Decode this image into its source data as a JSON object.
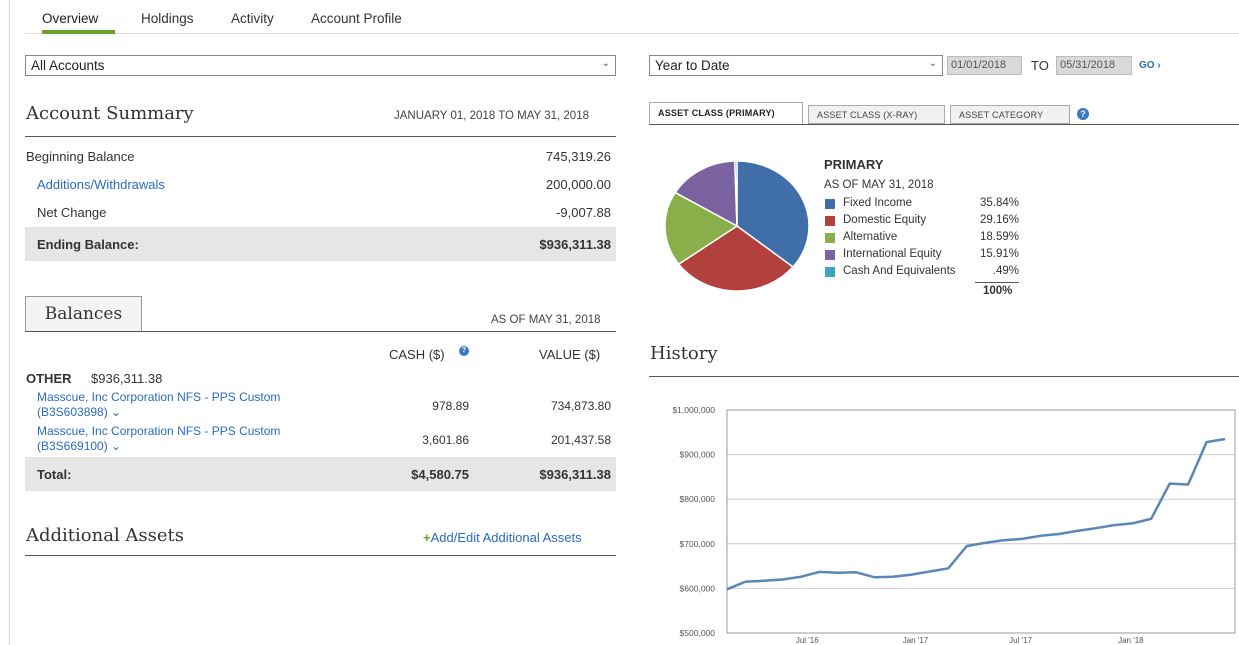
{
  "nav": {
    "tabs": [
      {
        "label": "Overview",
        "active": true
      },
      {
        "label": "Holdings",
        "active": false
      },
      {
        "label": "Activity",
        "active": false
      },
      {
        "label": "Account Profile",
        "active": false
      }
    ],
    "accent_color": "#6aa12c"
  },
  "filters": {
    "account_select": "All Accounts",
    "period_select": "Year to Date",
    "from_date": "01/01/2018",
    "to_label": "TO",
    "to_date": "05/31/2018",
    "go_label": "GO ›"
  },
  "account_summary": {
    "title": "Account Summary",
    "date_range": "JANUARY 01, 2018 TO MAY 31, 2018",
    "rows": [
      {
        "label": "Beginning Balance",
        "value": "745,319.26"
      },
      {
        "label": "Additions/Withdrawals",
        "value": "200,000.00"
      },
      {
        "label": "Net Change",
        "value": "-9,007.88"
      }
    ],
    "ending_label": "Ending Balance:",
    "ending_value": "$936,311.38"
  },
  "balances": {
    "title": "Balances",
    "as_of": "AS OF MAY 31, 2018",
    "col_cash": "CASH ($)",
    "col_value": "VALUE ($)",
    "group_label": "OTHER",
    "group_total": "$936,311.38",
    "accounts": [
      {
        "name_line1": "Masscue, Inc Corporation NFS - PPS Custom",
        "name_line2": "(B3S603898) ⌄",
        "cash": "978.89",
        "value": "734,873.80"
      },
      {
        "name_line1": "Masscue, Inc Corporation NFS - PPS Custom",
        "name_line2": "(B3S669100) ⌄",
        "cash": "3,601.86",
        "value": "201,437.58"
      }
    ],
    "total_label": "Total:",
    "total_cash": "$4,580.75",
    "total_value": "$936,311.38"
  },
  "additional_assets": {
    "title": "Additional Assets",
    "link": "Add/Edit Additional Assets",
    "link_plus": "+"
  },
  "asset_tabs": [
    {
      "label": "ASSET CLASS (PRIMARY)",
      "active": true
    },
    {
      "label": "ASSET CLASS (X-RAY)",
      "active": false
    },
    {
      "label": "ASSET CATEGORY",
      "active": false
    }
  ],
  "allocation": {
    "title": "PRIMARY",
    "as_of": "AS OF MAY 31, 2018",
    "total": "100%",
    "items": [
      {
        "label": "Fixed Income",
        "pct": "35.84%",
        "value": 35.84,
        "color": "#3f6ea8"
      },
      {
        "label": "Domestic Equity",
        "pct": "29.16%",
        "value": 29.16,
        "color": "#b2403c"
      },
      {
        "label": "Alternative",
        "pct": "18.59%",
        "value": 18.59,
        "color": "#8aae4a"
      },
      {
        "label": "International Equity",
        "pct": "15.91%",
        "value": 15.91,
        "color": "#7b62a0"
      },
      {
        "label": "Cash And Equivalents",
        "pct": ".49%",
        "value": 0.49,
        "color": "#3ea4bd"
      }
    ]
  },
  "history": {
    "title": "History"
  },
  "chart_data": {
    "type": "line",
    "title": "History",
    "y_ticks": [
      "$1,000,000",
      "$900,000",
      "$800,000",
      "$700,000",
      "$600,000",
      "$500,000"
    ],
    "x_ticks": [
      "Jul '16",
      "Jan '17",
      "Jul '17",
      "Jan '18"
    ],
    "ylim": [
      500000,
      1000000
    ],
    "line_color": "#5a86b8",
    "series": [
      {
        "values": [
          598000,
          615000,
          617000,
          620000,
          626000,
          637000,
          635000,
          636000,
          625000,
          626000,
          631000,
          638000,
          645000,
          695000,
          702000,
          708000,
          711000,
          718000,
          722000,
          729000,
          735000,
          742000,
          746000,
          756000,
          835000,
          833000,
          928000,
          935000
        ]
      }
    ]
  }
}
